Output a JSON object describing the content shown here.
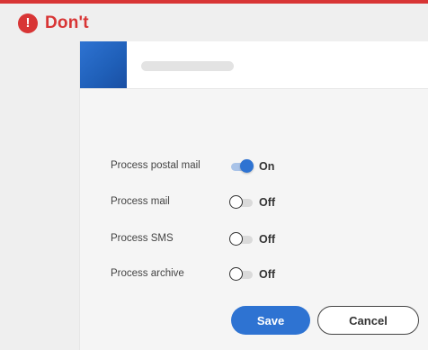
{
  "banner": {
    "icon": "alert-icon",
    "icon_glyph": "!",
    "label": "Don't",
    "color": "#d83535"
  },
  "panel": {
    "brand_color": "#2e73d2"
  },
  "settings": [
    {
      "label": "Process postal mail",
      "state": "On",
      "on": true
    },
    {
      "label": "Process mail",
      "state": "Off",
      "on": false
    },
    {
      "label": "Process SMS",
      "state": "Off",
      "on": false
    },
    {
      "label": "Process archive",
      "state": "Off",
      "on": false
    }
  ],
  "actions": {
    "save_label": "Save",
    "cancel_label": "Cancel"
  }
}
